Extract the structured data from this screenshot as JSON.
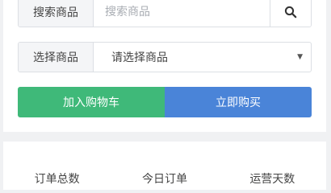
{
  "search": {
    "label": "搜索商品",
    "placeholder": "搜索商品",
    "button_icon": "search-icon"
  },
  "product_select": {
    "label": "选择商品",
    "selected": "请选择商品"
  },
  "actions": {
    "add_to_cart": "加入购物车",
    "buy_now": "立即购买",
    "add_to_cart_color": "#3fb979",
    "buy_now_color": "#4a84d8"
  },
  "stats": [
    {
      "label": "订单总数"
    },
    {
      "label": "今日订单"
    },
    {
      "label": "运营天数"
    }
  ]
}
